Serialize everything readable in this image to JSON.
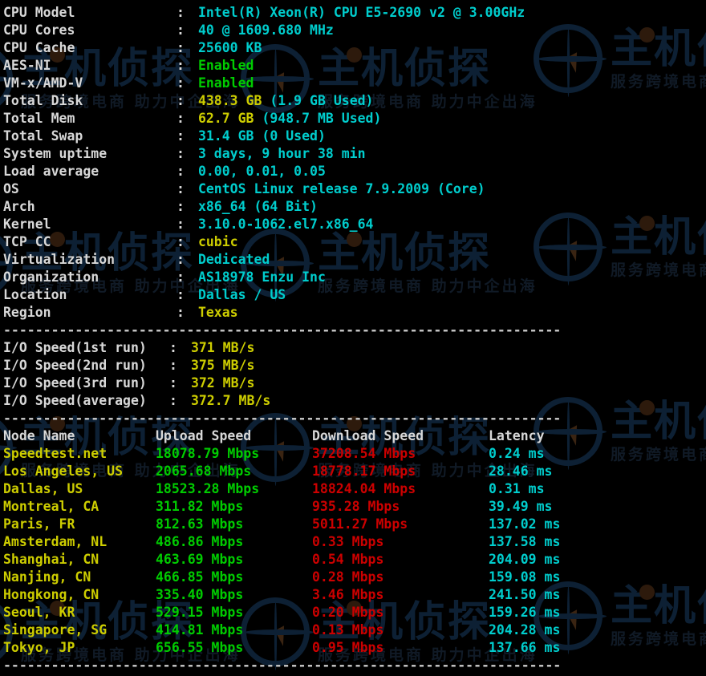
{
  "watermark": {
    "main_text": "主机侦探",
    "sub_text": "服务跨境电商 助力中企出海",
    "globe_icon": "globe-icon",
    "cursor_icon": "cursor-arrow-icon"
  },
  "colors": {
    "background": "#000000",
    "label": "#d8d8d8",
    "cyan": "#00cdcd",
    "green": "#00cc00",
    "yellow": "#cdcd00",
    "red": "#cc0000"
  },
  "system_info": [
    {
      "label": "CPU Model",
      "value": "Intel(R) Xeon(R) CPU E5-2690 v2 @ 3.00GHz",
      "color": "cyan"
    },
    {
      "label": "CPU Cores",
      "value": "40 @ 1609.680 MHz",
      "color": "cyan"
    },
    {
      "label": "CPU Cache",
      "value": "25600 KB",
      "color": "cyan"
    },
    {
      "label": "AES-NI",
      "value": "Enabled",
      "color": "green"
    },
    {
      "label": "VM-x/AMD-V",
      "value": "Enabled",
      "color": "green"
    },
    {
      "label": "Total Disk",
      "value": "438.3 GB",
      "value2": "(1.9 GB Used)",
      "color": "yellow"
    },
    {
      "label": "Total Mem",
      "value": "62.7 GB",
      "value2": "(948.7 MB Used)",
      "color": "yellow"
    },
    {
      "label": "Total Swap",
      "value": "31.4 GB",
      "value2": "(0 Used)",
      "color": "cyan"
    },
    {
      "label": "System uptime",
      "value": "3 days, 9 hour 38 min",
      "color": "cyan"
    },
    {
      "label": "Load average",
      "value": "0.00, 0.01, 0.05",
      "color": "cyan"
    },
    {
      "label": "OS",
      "value": "CentOS Linux release 7.9.2009 (Core)",
      "color": "cyan"
    },
    {
      "label": "Arch",
      "value": "x86_64 (64 Bit)",
      "color": "cyan"
    },
    {
      "label": "Kernel",
      "value": "3.10.0-1062.el7.x86_64",
      "color": "cyan"
    },
    {
      "label": "TCP CC",
      "value": "cubic",
      "color": "yellow"
    },
    {
      "label": "Virtualization",
      "value": "Dedicated",
      "color": "cyan"
    },
    {
      "label": "Organization",
      "value": "AS18978 Enzu Inc",
      "color": "cyan"
    },
    {
      "label": "Location",
      "value": "Dallas / US",
      "color": "cyan"
    },
    {
      "label": "Region",
      "value": "Texas",
      "color": "yellow"
    }
  ],
  "io_speed": [
    {
      "label": "I/O Speed(1st run)",
      "value": "371 MB/s"
    },
    {
      "label": "I/O Speed(2nd run)",
      "value": "375 MB/s"
    },
    {
      "label": "I/O Speed(3rd run)",
      "value": "372 MB/s"
    },
    {
      "label": "I/O Speed(average)",
      "value": "372.7 MB/s"
    }
  ],
  "speedtest": {
    "headers": {
      "node": "Node Name",
      "upload": "Upload Speed",
      "download": "Download Speed",
      "latency": "Latency"
    },
    "rows": [
      {
        "node": "Speedtest.net",
        "upload": "18078.79 Mbps",
        "download": "37208.54 Mbps",
        "latency": "0.24 ms"
      },
      {
        "node": "Los Angeles, US",
        "upload": "2065.68 Mbps",
        "download": "18778.17 Mbps",
        "latency": "28.46 ms"
      },
      {
        "node": "Dallas, US",
        "upload": "18523.28 Mbps",
        "download": "18824.04 Mbps",
        "latency": "0.31 ms"
      },
      {
        "node": "Montreal, CA",
        "upload": "311.82 Mbps",
        "download": "935.28 Mbps",
        "latency": "39.49 ms"
      },
      {
        "node": "Paris, FR",
        "upload": "812.63 Mbps",
        "download": "5011.27 Mbps",
        "latency": "137.02 ms"
      },
      {
        "node": "Amsterdam, NL",
        "upload": "486.86 Mbps",
        "download": "0.33 Mbps",
        "latency": "137.58 ms"
      },
      {
        "node": "Shanghai, CN",
        "upload": "463.69 Mbps",
        "download": "0.54 Mbps",
        "latency": "204.09 ms"
      },
      {
        "node": "Nanjing, CN",
        "upload": "466.85 Mbps",
        "download": "0.28 Mbps",
        "latency": "159.08 ms"
      },
      {
        "node": "Hongkong, CN",
        "upload": "335.40 Mbps",
        "download": "3.46 Mbps",
        "latency": "241.50 ms"
      },
      {
        "node": "Seoul, KR",
        "upload": "529.15 Mbps",
        "download": "0.20 Mbps",
        "latency": "159.26 ms"
      },
      {
        "node": "Singapore, SG",
        "upload": "414.81 Mbps",
        "download": "0.13 Mbps",
        "latency": "204.28 ms"
      },
      {
        "node": "Tokyo, JP",
        "upload": "656.55 Mbps",
        "download": "0.95 Mbps",
        "latency": "137.66 ms"
      }
    ]
  },
  "separator": "----------------------------------------------------------------------"
}
